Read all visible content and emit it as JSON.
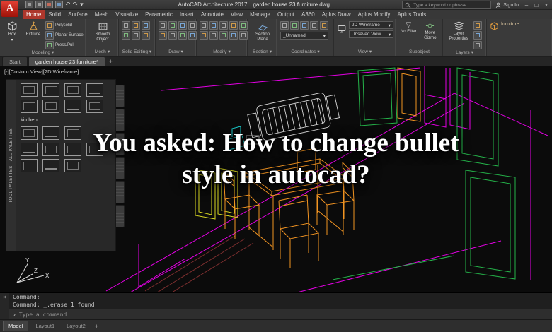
{
  "titlebar": {
    "app_name": "AutoCAD Architecture 2017",
    "doc_name": "garden house 23 furniture.dwg",
    "search_placeholder": "Type a keyword or phrase",
    "sign_in_label": "Sign In"
  },
  "icons": {
    "dropdown": "▾",
    "minimize": "–",
    "maximize": "□",
    "close": "×",
    "undo": "↶",
    "redo": "↷",
    "prompt": "›",
    "add": "+",
    "no_filter": "▽",
    "search_hint_divider": "|"
  },
  "ribbon_tabs": [
    {
      "label": "Home"
    },
    {
      "label": "Solid"
    },
    {
      "label": "Surface"
    },
    {
      "label": "Mesh"
    },
    {
      "label": "Visualize"
    },
    {
      "label": "Parametric"
    },
    {
      "label": "Insert"
    },
    {
      "label": "Annotate"
    },
    {
      "label": "View"
    },
    {
      "label": "Manage"
    },
    {
      "label": "Output"
    },
    {
      "label": "A360"
    },
    {
      "label": "Aplus Draw"
    },
    {
      "label": "Aplus Modify"
    },
    {
      "label": "Aplus Tools"
    }
  ],
  "ribbon": {
    "modeling": {
      "box": "Box",
      "extrude": "Extrude",
      "polysolid": "Polysolid",
      "planar_surface": "Planar Surface",
      "press_pull": "Press/Pull",
      "label": "Modeling"
    },
    "mesh": {
      "smooth_object": "Smooth Object",
      "label": "Mesh"
    },
    "solid_editing": {
      "label": "Solid Editing"
    },
    "draw": {
      "label": "Draw"
    },
    "modify": {
      "label": "Modify"
    },
    "section": {
      "section_plane": "Section Plane",
      "label": "Section"
    },
    "coordinates": {
      "ucs_name": "_Unnamed",
      "label": "Coordinates"
    },
    "view": {
      "visual_style": "2D Wireframe",
      "view_name": "Unsaved View",
      "label": "View"
    },
    "subobject": {
      "no_filter": "No Filter",
      "move_gizmo": "Move Gizmo",
      "label": "Subobject"
    },
    "layers": {
      "layer_properties": "Layer Properties",
      "label": "Layers"
    },
    "furniture_tool": "furniture"
  },
  "file_tabs": {
    "start": "Start",
    "drawing": "garden house 23 furniture*"
  },
  "viewport": {
    "controls": "[-][Custom View][2D Wireframe]"
  },
  "palette": {
    "title": "TOOL PALETTES - ALL PALETTES",
    "group_label": "kitchen"
  },
  "ucs": {
    "x": "X",
    "y": "Y",
    "z": "Z"
  },
  "command": {
    "line1": "Command:",
    "line2": "Command: _.erase 1 found",
    "input_placeholder": "Type a command"
  },
  "statusbar": {
    "model": "Model",
    "layout1": "Layout1",
    "layout2": "Layout2"
  },
  "overlay": {
    "line1": "You asked: How to change bullet",
    "line2": "style in autocad?"
  }
}
